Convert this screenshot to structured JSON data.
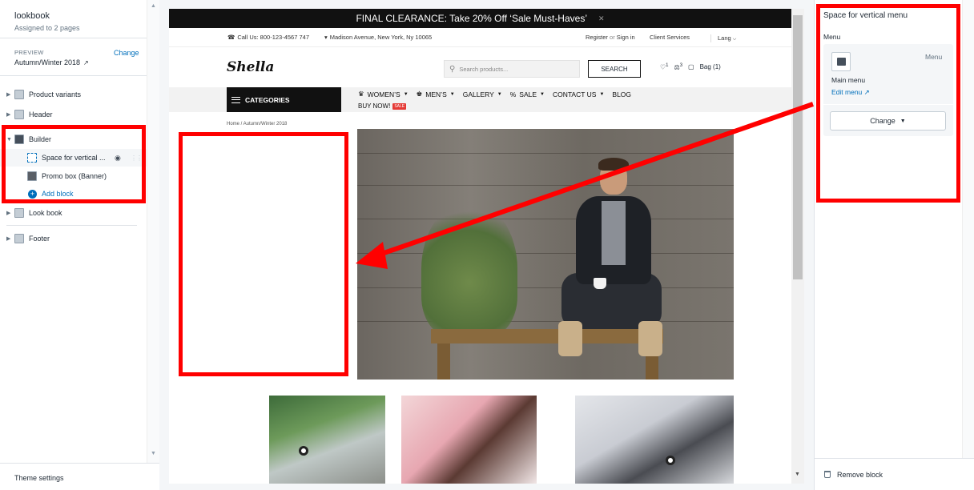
{
  "left_panel": {
    "title": "lookbook",
    "subtitle": "Assigned to 2 pages",
    "preview_label": "PREVIEW",
    "preview_value": "Autumn/Winter 2018",
    "change_label": "Change",
    "sections": [
      {
        "label": "Product variants",
        "icon": "section-icon"
      },
      {
        "label": "Header",
        "icon": "header-section-icon"
      },
      {
        "label": "Builder",
        "icon": "builder-section-icon"
      },
      {
        "label": "Look book",
        "icon": "lookbook-section-icon"
      },
      {
        "label": "Footer",
        "icon": "footer-section-icon"
      }
    ],
    "builder_blocks": [
      {
        "label": "Space for vertical ..."
      },
      {
        "label": "Promo box (Banner)"
      }
    ],
    "add_block_label": "Add block",
    "theme_settings_label": "Theme settings"
  },
  "store": {
    "promo_text": "FINAL CLEARANCE: Take 20% Off ‘Sale Must-Haves’",
    "phone": "Call Us: 800-123-4567 747",
    "address": "Madison Avenue, New York, Ny 10065",
    "register": "Register",
    "or": "or",
    "sign_in": "Sign in",
    "client_services": "Client Services",
    "lang": "Lang",
    "logo": "Shella",
    "search_placeholder": "Search products...",
    "search_button": "SEARCH",
    "wishlist_count": "1",
    "compare_count": "3",
    "bag_label": "Bag (1)",
    "categories_label": "CATEGORIES",
    "nav": [
      "WOMEN’S",
      "MEN’S",
      "GALLERY",
      "SALE",
      "CONTACT US",
      "BLOG"
    ],
    "buy_now": "BUY NOW!",
    "sale_badge": "SALE",
    "breadcrumb": "Home  /  Autumn/Winter 2018"
  },
  "right_panel": {
    "title": "Space for vertical menu",
    "menu_label": "Menu",
    "menu_word": "Menu",
    "main_menu": "Main menu",
    "edit_menu": "Edit menu",
    "change_button": "Change",
    "remove_block": "Remove block"
  },
  "colors": {
    "annotation_red": "#ff0000",
    "link_blue": "#006fbb",
    "promo_bar": "#111111"
  }
}
